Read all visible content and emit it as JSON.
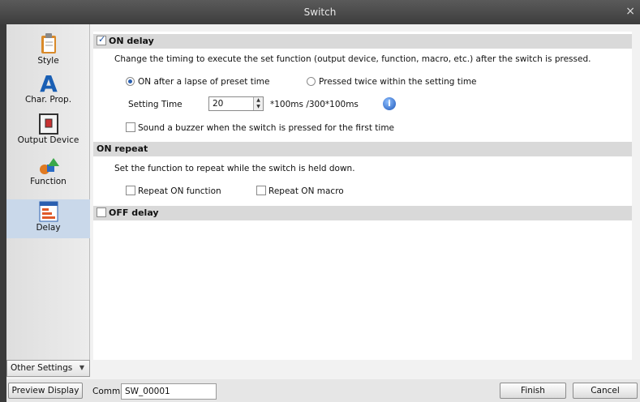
{
  "window": {
    "title": "Switch",
    "close_glyph": "×"
  },
  "sidebar": {
    "items": [
      {
        "label": "Style",
        "icon": "style-icon"
      },
      {
        "label": "Char. Prop.",
        "icon": "char-prop-icon"
      },
      {
        "label": "Output Device",
        "icon": "output-device-icon"
      },
      {
        "label": "Function",
        "icon": "function-icon"
      },
      {
        "label": "Delay",
        "icon": "delay-icon"
      }
    ],
    "other_settings": "Other Settings"
  },
  "on_delay": {
    "header": "ON delay",
    "checked": true,
    "description": "Change the timing to execute the set function (output device, function, macro, etc.) after the switch is pressed.",
    "radio_1": "ON after a lapse of preset time",
    "radio_2": "Pressed twice within the setting time",
    "setting_time_label": "Setting Time",
    "setting_time_value": "20",
    "setting_time_unit": "*100ms /300*100ms",
    "buzzer_label": "Sound a buzzer when the switch is pressed for the first time"
  },
  "on_repeat": {
    "header": "ON repeat",
    "description": "Set the function to repeat while the switch is held down.",
    "repeat_function": "Repeat ON function",
    "repeat_macro": "Repeat ON macro"
  },
  "off_delay": {
    "header": "OFF delay"
  },
  "footer": {
    "preview_display": "Preview Display",
    "comm_label": "Comm",
    "comm_value": "SW_00001",
    "finish": "Finish",
    "cancel": "Cancel"
  },
  "colors": {
    "title_bar": "#3d3d3d",
    "section_header": "#d9d9d9",
    "accent": "#2a5fb0"
  }
}
